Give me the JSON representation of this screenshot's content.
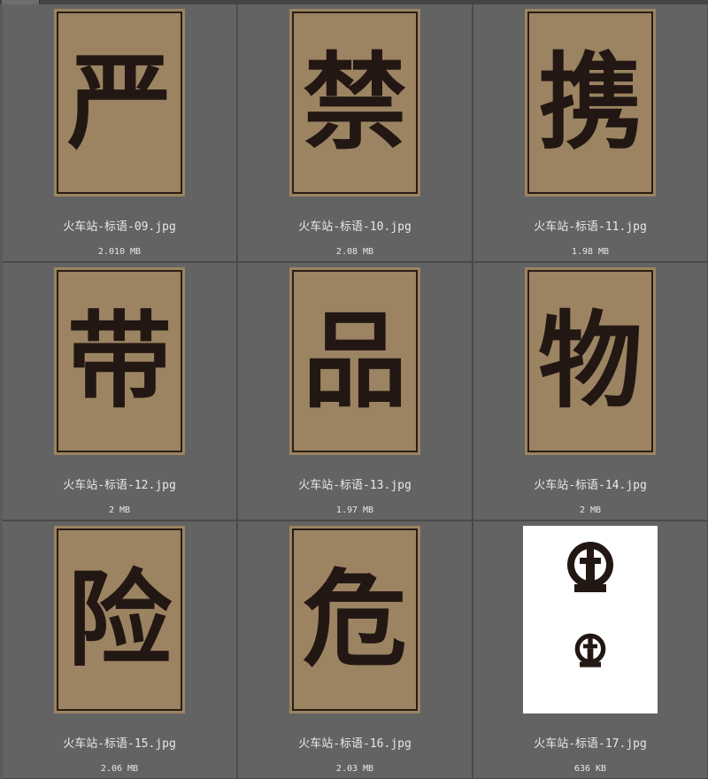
{
  "files": [
    {
      "glyph": "严",
      "name": "火车站-标语-09.jpg",
      "size": "2.010 MB",
      "style": "poster"
    },
    {
      "glyph": "禁",
      "name": "火车站-标语-10.jpg",
      "size": "2.08 MB",
      "style": "poster"
    },
    {
      "glyph": "携",
      "name": "火车站-标语-11.jpg",
      "size": "1.98 MB",
      "style": "poster"
    },
    {
      "glyph": "带",
      "name": "火车站-标语-12.jpg",
      "size": "2 MB",
      "style": "poster"
    },
    {
      "glyph": "品",
      "name": "火车站-标语-13.jpg",
      "size": "1.97 MB",
      "style": "poster"
    },
    {
      "glyph": "物",
      "name": "火车站-标语-14.jpg",
      "size": "2 MB",
      "style": "poster"
    },
    {
      "glyph": "险",
      "name": "火车站-标语-15.jpg",
      "size": "2.06 MB",
      "style": "poster"
    },
    {
      "glyph": "危",
      "name": "火车站-标语-16.jpg",
      "size": "2.03 MB",
      "style": "poster"
    },
    {
      "glyph": "",
      "name": "火车站-标语-17.jpg",
      "size": "636 KB",
      "style": "logo"
    }
  ],
  "colors": {
    "poster_bg": "#9c8462",
    "ink": "#231714",
    "panel_bg": "#636363"
  },
  "icons": {
    "railway_logo": "china-railway-logo-icon"
  }
}
